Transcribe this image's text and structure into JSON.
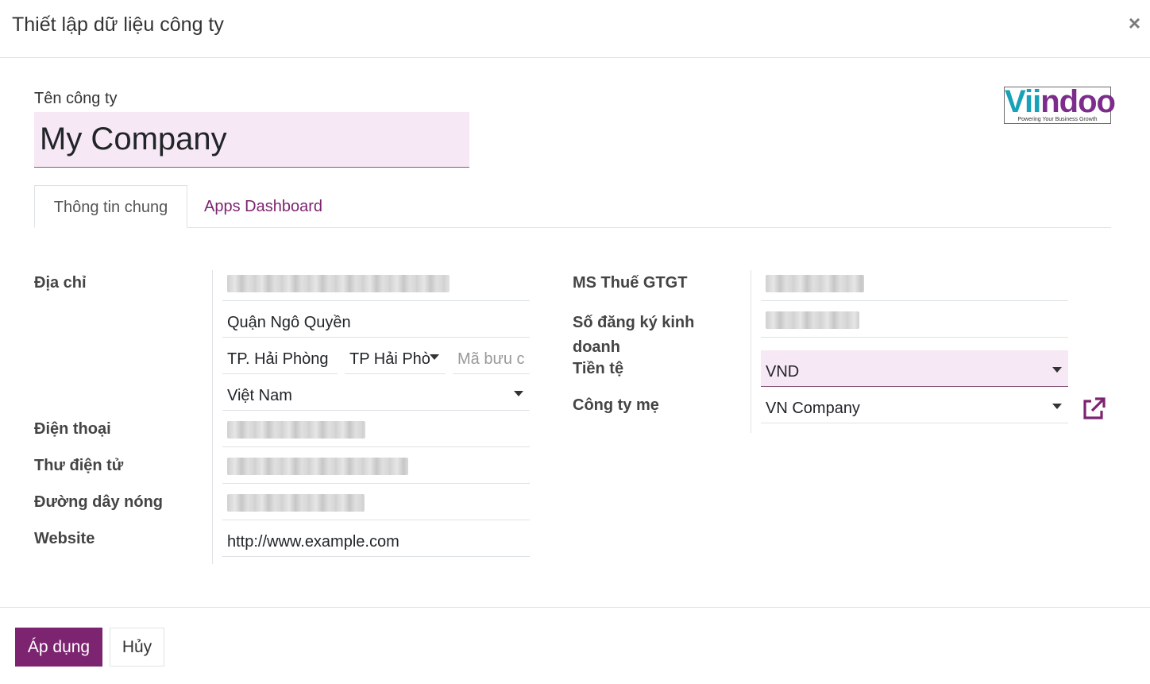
{
  "dialog": {
    "title": "Thiết lập dữ liệu công ty",
    "close_symbol": "×"
  },
  "company": {
    "name_label": "Tên công ty",
    "name_value": "My Company"
  },
  "logo": {
    "brand_1": "Vi",
    "brand_2": "ndoo",
    "tagline": "Powering Your Business Growth"
  },
  "tabs": [
    {
      "label": "Thông tin chung",
      "active": true
    },
    {
      "label": "Apps Dashboard",
      "active": false
    }
  ],
  "left": {
    "address_label": "Địa chỉ",
    "street2": "Quận Ngô Quyền",
    "city": "TP. Hải Phòng",
    "state": "TP Hải Phò",
    "zip_placeholder": "Mã bưu c",
    "country": "Việt Nam",
    "phone_label": "Điện thoại",
    "email_label": "Thư điện tử",
    "hotline_label": "Đường dây nóng",
    "website_label": "Website",
    "website_value": "http://www.example.com"
  },
  "right": {
    "vat_label": "MS Thuế GTGT",
    "reg_label": "Số đăng ký kinh doanh",
    "currency_label": "Tiền tệ",
    "currency_value": "VND",
    "parent_label": "Công ty mẹ",
    "parent_value": "VN Company"
  },
  "footer": {
    "apply_label": "Áp dụng",
    "cancel_label": "Hủy"
  },
  "colors": {
    "accent": "#7c2470",
    "required_bg": "#f6e8f4",
    "logo_teal": "#17a2b8",
    "logo_purple": "#7c2d8c"
  },
  "icons": {
    "close": "close-icon",
    "dropdown": "caret-down-icon",
    "external_link": "external-link-icon"
  }
}
